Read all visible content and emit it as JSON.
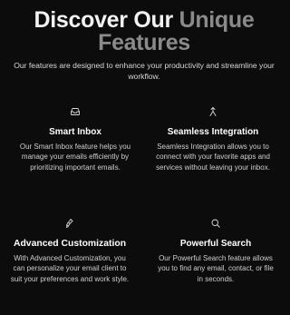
{
  "headline": {
    "line1_white": "Discover Our ",
    "line1_gray": "Unique",
    "line2_gray": "Features"
  },
  "subtitle": "Our features are designed to enhance your productivity and streamline your workflow.",
  "features": [
    {
      "icon": "inbox-icon",
      "title": "Smart Inbox",
      "desc": "Our Smart Inbox feature helps you manage your emails efficiently by prioritizing important emails."
    },
    {
      "icon": "merge-arrow-icon",
      "title": "Seamless Integration",
      "desc": "Seamless Integration allows you to connect with your favorite apps and services without leaving your inbox."
    },
    {
      "icon": "brush-icon",
      "title": "Advanced Customization",
      "desc": "With Advanced Customization, you can personalize your email client to suit your preferences and work style."
    },
    {
      "icon": "search-icon",
      "title": "Powerful Search",
      "desc": "Our Powerful Search feature allows you to find any email, contact, or file in seconds."
    }
  ]
}
